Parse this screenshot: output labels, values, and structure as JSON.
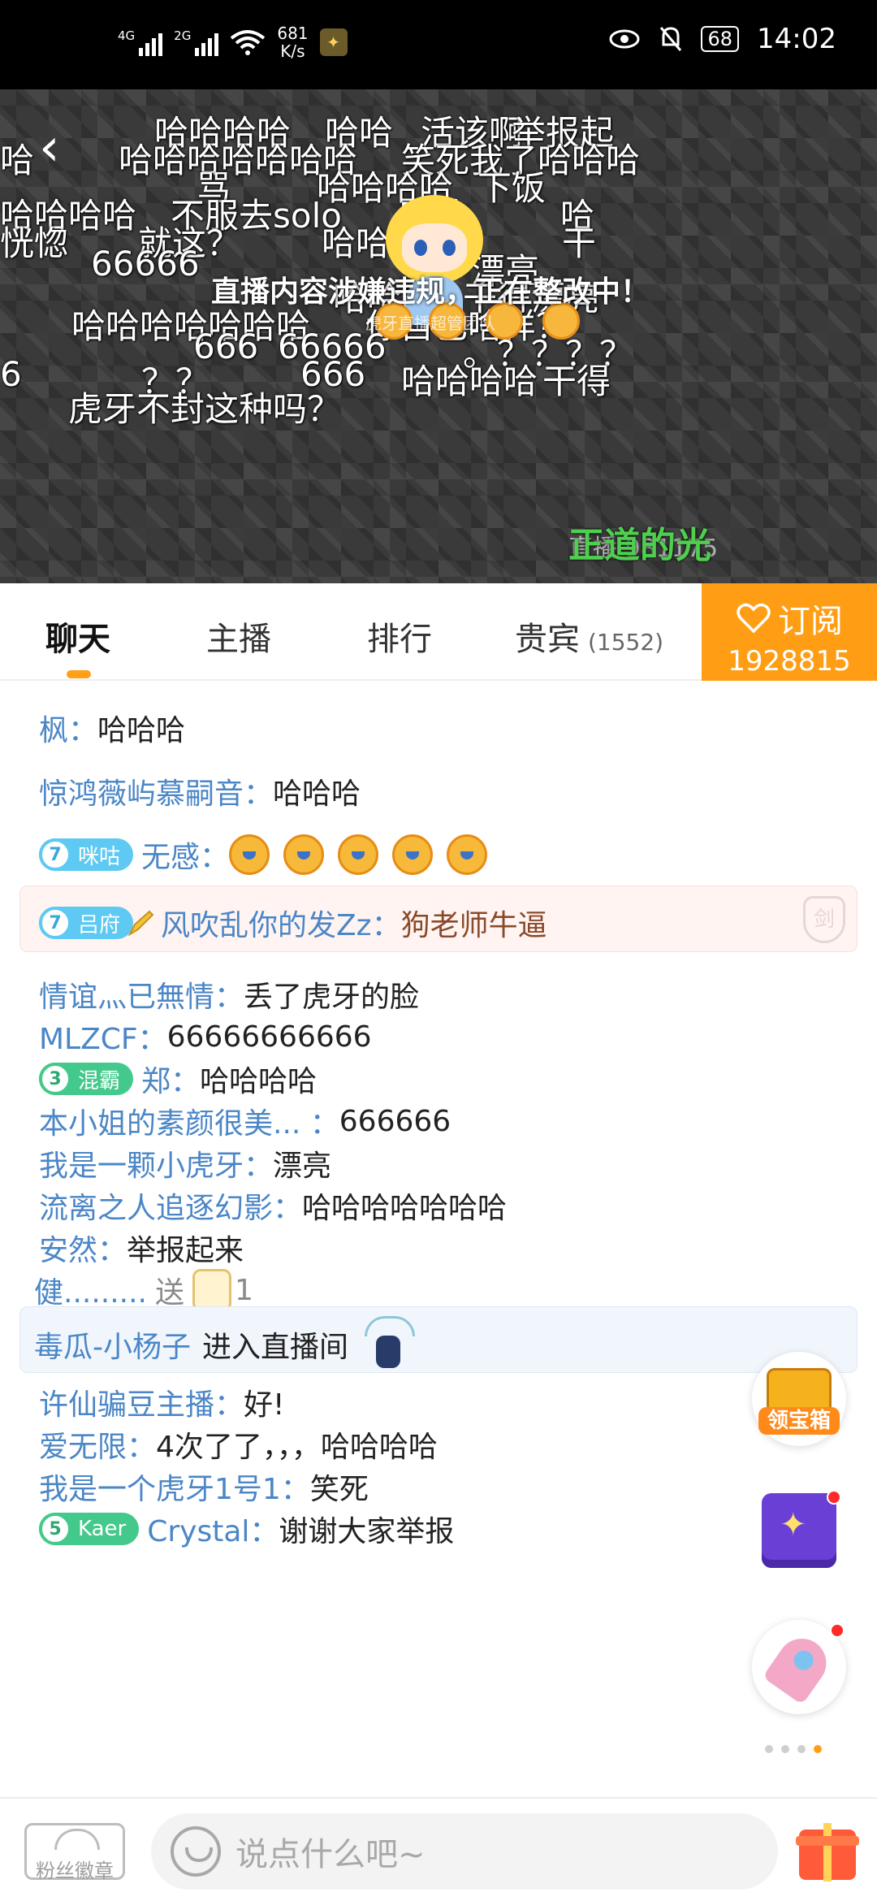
{
  "status_bar": {
    "net_speed_value": "681",
    "net_speed_unit": "K/s",
    "signal1_label": "4G",
    "signal2_label": "2G",
    "battery": "68",
    "time": "14:02"
  },
  "video": {
    "danmaku": [
      "哈哈哈哈",
      "哈哈",
      "活该啊",
      "举报起",
      "哈",
      "哈哈哈哈哈哈哈",
      "笑死我了哈哈哈",
      "骂",
      "哈哈哈哈",
      "下饭",
      "哈哈哈哈",
      "不服去solo",
      "哈哈",
      "哈",
      "恍惚",
      "就这？",
      "哈哈哈",
      "干",
      "66666",
      "漂亮",
      "哈哈哈",
      "干得漂亮",
      "哈哈哈哈哈哈哈",
      "你自己啥样？",
      "666",
      "66666",
      "。？？？？",
      "6",
      "？？",
      "666",
      "哈哈哈哈",
      "干得",
      "虎牙不封这种吗？"
    ],
    "notice": "直播内容涉嫌违规，正在整改中！",
    "notice_sub": "虎牙直播超管团队",
    "room_info": "直播 981175",
    "green_danmaku": "正道的光"
  },
  "tabs": {
    "chat": "聊天",
    "anchor": "主播",
    "rank": "排行",
    "vip": "贵宾",
    "vip_count": "(1552)",
    "subscribe_label": "订阅",
    "subscribe_count": "1928815"
  },
  "chat": [
    {
      "user": "枫：",
      "msg": "哈哈哈"
    },
    {
      "user": "惊鸿薇屿慕嗣音：",
      "msg": "哈哈哈"
    },
    {
      "badge_level": "7",
      "badge_name": "咪咕",
      "user": "无感：",
      "emoji_count": 5
    },
    {
      "badge_level": "7",
      "badge_name": "吕府",
      "user": "风吹乱你的发Zz：",
      "msg": "狗老师牛逼",
      "sword": "剑"
    },
    {
      "user": "情谊灬已無情：",
      "msg": "丢了虎牙的脸"
    },
    {
      "user": "MLZCF：",
      "msg": "66666666666"
    },
    {
      "badge_level": "3",
      "badge_name": "混霸",
      "user": "郑：",
      "msg": "哈哈哈哈"
    },
    {
      "user": "本小姐的素颜很美...  ：",
      "msg": "666666"
    },
    {
      "user": "我是一颗小虎牙：",
      "msg": "漂亮"
    },
    {
      "user": "流离之人追逐幻影：",
      "msg": "哈哈哈哈哈哈哈"
    },
    {
      "user": "安然：",
      "msg": "举报起来"
    },
    {
      "user": "健.........",
      "send": "送",
      "count": "1"
    },
    {
      "user": "毒瓜-小杨子",
      "msg": "进入直播间"
    },
    {
      "user": "许仙骗豆主播：",
      "msg": "好!"
    },
    {
      "user": "爱无限：",
      "msg": "4次了了，，，哈哈哈哈"
    },
    {
      "user": "我是一个虎牙1号1：",
      "msg": "笑死"
    },
    {
      "badge_level": "5",
      "badge_name": "Kaer",
      "user": "Crystal：",
      "msg": "谢谢大家举报"
    }
  ],
  "floating": {
    "treasure_label": "领宝箱"
  },
  "bottom": {
    "fan_badge": "粉丝徽章",
    "input_placeholder": "说点什么吧~"
  },
  "colors": {
    "accent": "#ff9e14",
    "username": "#4b86c6",
    "danmaku_green": "#4ed04e"
  }
}
